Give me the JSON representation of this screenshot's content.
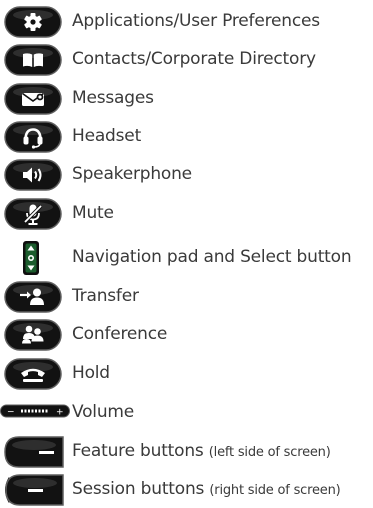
{
  "colors": {
    "button_body": "#121212",
    "button_rim": "#5e5e5e",
    "glyph": "#ffffff",
    "nav_pad": "#1b5c2d",
    "nav_frame": "#0f0f0f",
    "label_text": "#3a3a3a"
  },
  "items": [
    {
      "icon": "gear-icon",
      "label": "Applications/User Preferences"
    },
    {
      "icon": "book-icon",
      "label": "Contacts/Corporate Directory"
    },
    {
      "icon": "envelope-icon",
      "label": "Messages"
    },
    {
      "icon": "headset-icon",
      "label": "Headset"
    },
    {
      "icon": "speaker-icon",
      "label": "Speakerphone"
    },
    {
      "icon": "mute-microphone-icon",
      "label": "Mute"
    },
    {
      "icon": "navigation-pad-icon",
      "label": "Navigation pad and Select button"
    },
    {
      "icon": "transfer-icon",
      "label": "Transfer"
    },
    {
      "icon": "conference-icon",
      "label": "Conference"
    },
    {
      "icon": "hold-icon",
      "label": "Hold"
    },
    {
      "icon": "volume-rocker-icon",
      "label": "Volume",
      "minus": "−",
      "plus": "+"
    },
    {
      "icon": "feature-button-icon",
      "label": "Feature buttons",
      "note": "(left side of screen)"
    },
    {
      "icon": "session-button-icon",
      "label": "Session buttons",
      "note": "(right side of screen)"
    }
  ]
}
